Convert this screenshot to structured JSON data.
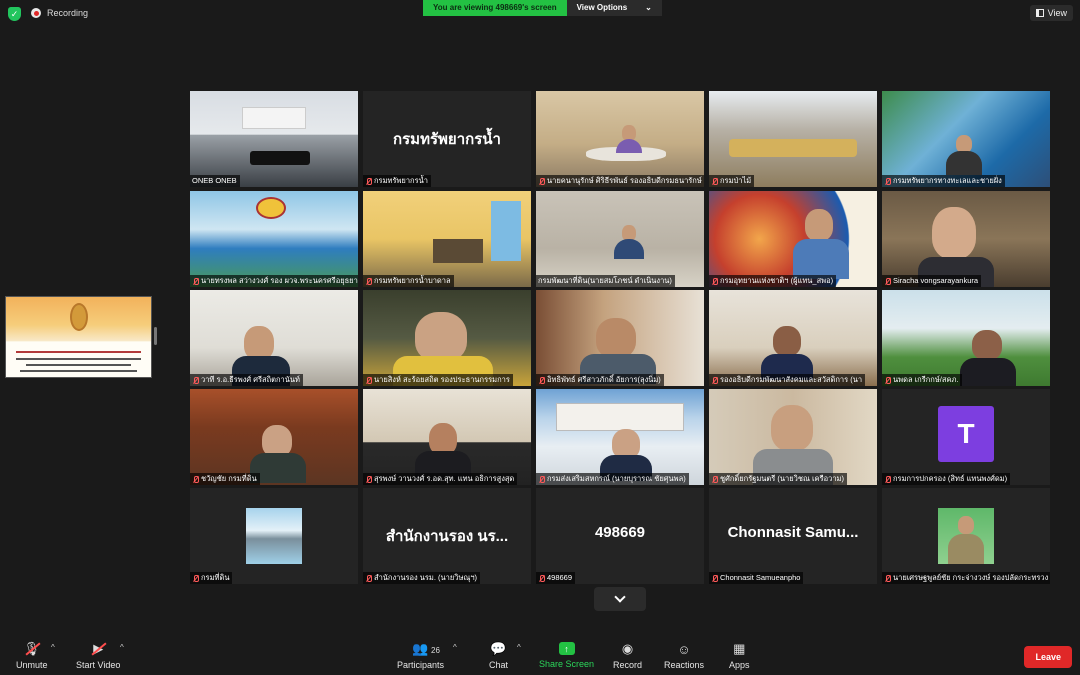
{
  "top": {
    "recording": "Recording",
    "viewing": "You are viewing 498669's screen",
    "view_options": "View Options",
    "view": "View"
  },
  "tiles": [
    {
      "name": "ONEB ONEB",
      "type": "video",
      "active": true
    },
    {
      "name": "กรมทรัพยากรน้ำ",
      "type": "name",
      "display": "กรมทรัพยากรน้ำ"
    },
    {
      "name": "นายคนานุรักษ์ ศิริธีรพันธ์ รองอธิบดีกรมธนารักษ์",
      "type": "video"
    },
    {
      "name": "กรมป่าไม้",
      "type": "video"
    },
    {
      "name": "กรมทรัพยากรทางทะเลและชายฝั่ง",
      "type": "video"
    },
    {
      "name": "นายทรงพล สว่างวงศ์ รอง ผวจ.พระนครศรีอยุธยา สป.",
      "type": "video"
    },
    {
      "name": "กรมทรัพยากรน้ำบาดาล",
      "type": "video"
    },
    {
      "name": "กรมพัฒนาที่ดิน(นายสมโภชน์ ดำเนินงาน)",
      "type": "video"
    },
    {
      "name": "กรมอุทยานแห่งชาติฯ (ผู้แทน_สพอ)",
      "type": "video"
    },
    {
      "name": "Siracha vongsarayankura",
      "type": "video"
    },
    {
      "name": "วาที ร.อ.ธีรพงศ์ ศรีสถิตกานันท์",
      "type": "video"
    },
    {
      "name": "นายสิงห์ สะร้อยสถิต รองประธานกรรมการ",
      "type": "video"
    },
    {
      "name": "อิทธิพัทธ์ ศรีสาวภักดิ์ อัยการ(ลุงนิ่ม)",
      "type": "video"
    },
    {
      "name": "รองอธิบดีกรมพัฒนาสังคมและสวัสดิการ (นา",
      "type": "video"
    },
    {
      "name": "นพดล เกรีกกษ์/สคภ.",
      "type": "video"
    },
    {
      "name": "ชวัญชัย กรมที่ดิน",
      "type": "video"
    },
    {
      "name": "สุรพงษ์ วานวงศ์ ร.อด.สุท. แทน อธิการสูงสุด",
      "type": "video"
    },
    {
      "name": "กรมส่งเสริมสหกรณ์ (นายบุรารณ ชัยศุนพล)",
      "type": "video"
    },
    {
      "name": "ชูศักดิ์ยกรัฐมนตรี (นายวิชณ เครือวาม)",
      "type": "video"
    },
    {
      "name": "กรมการปกครอง (สิทธ์ แทนพงศ์ดม)",
      "type": "avatar",
      "initial": "T"
    },
    {
      "name": "กรมที่ดิน",
      "type": "image"
    },
    {
      "name": "สำนักงานรอง นรม. (นายวิษณุฯ)",
      "type": "name",
      "display": "สำนักงานรอง นร..."
    },
    {
      "name": "498669",
      "type": "name",
      "display": "498669"
    },
    {
      "name": "Chonnasit Samueanpho",
      "type": "name",
      "display": "Chonnasit Samu..."
    },
    {
      "name": "นายเศรษฐพูลย์ชัย กระจ่างวงษ์ รองปลัดกระทรวง",
      "type": "video"
    }
  ],
  "toolbar": {
    "unmute": "Unmute",
    "start_video": "Start Video",
    "participants": "Participants",
    "participants_count": "26",
    "chat": "Chat",
    "share_screen": "Share Screen",
    "record": "Record",
    "reactions": "Reactions",
    "apps": "Apps",
    "leave": "Leave"
  },
  "colors": {
    "accent_green": "#23c143",
    "leave_red": "#e02828",
    "active_speaker": "#d4e32e",
    "avatar_purple": "#7d3ee0"
  }
}
